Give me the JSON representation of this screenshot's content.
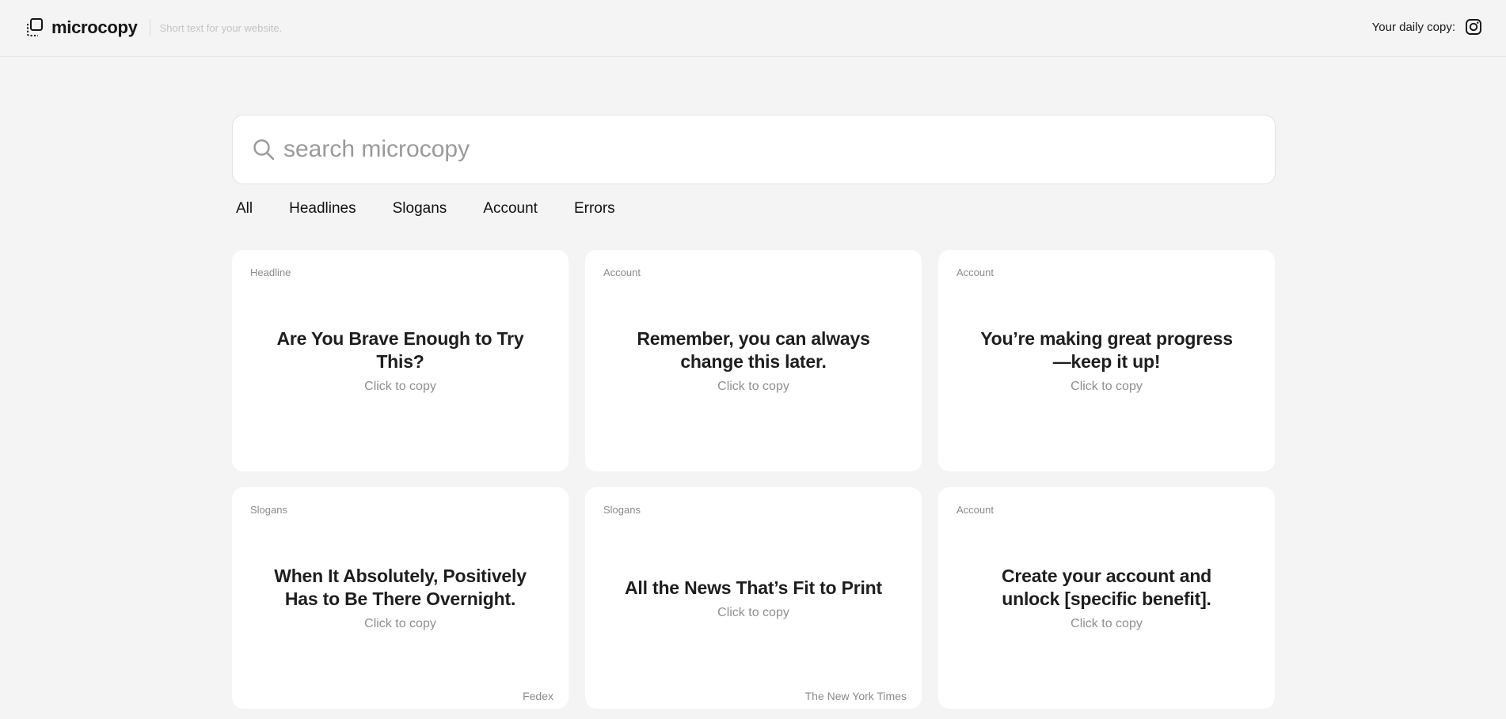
{
  "header": {
    "brand_name": "microcopy",
    "tagline": "Short text for your website.",
    "daily_label": "Your daily copy:",
    "social_icon": "instagram-icon"
  },
  "search": {
    "placeholder": "search microcopy",
    "value": "",
    "icon": "search-icon"
  },
  "tabs": [
    {
      "label": "All"
    },
    {
      "label": "Headlines"
    },
    {
      "label": "Slogans"
    },
    {
      "label": "Account"
    },
    {
      "label": "Errors"
    }
  ],
  "cards": [
    {
      "category": "Headline",
      "text": "Are You Brave Enough to Try This?",
      "hint": "Click to copy",
      "source": ""
    },
    {
      "category": "Account",
      "text": "Remember, you can always change this later.",
      "hint": "Click to copy",
      "source": ""
    },
    {
      "category": "Account",
      "text": "You’re making great progress—keep it up!",
      "hint": "Click to copy",
      "source": ""
    },
    {
      "category": "Slogans",
      "text": "When It Absolutely, Positively Has to Be There Overnight.",
      "hint": "Click to copy",
      "source": "Fedex"
    },
    {
      "category": "Slogans",
      "text": "All the News That’s Fit to Print",
      "hint": "Click to copy",
      "source": "The New York Times"
    },
    {
      "category": "Account",
      "text": "Create your account and unlock [specific benefit].",
      "hint": "Click to copy",
      "source": ""
    }
  ],
  "colors": {
    "background": "#f4f4f4",
    "card": "#ffffff",
    "muted_text": "#8f8f8f"
  }
}
